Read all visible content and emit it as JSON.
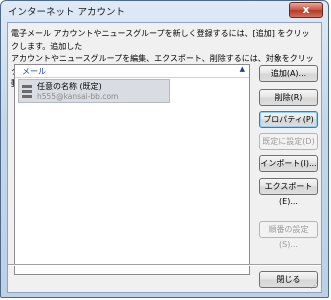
{
  "window": {
    "title": "インターネット アカウント",
    "close_glyph": "x"
  },
  "description": "電子メール アカウントやニュースグループを新しく登録するには、[追加] をクリックします。追加した\nアカウントやニュースグループを編集、エクスポート、削除するには、対象をクリックしてから、希望の\n動作をクリックします。",
  "list": {
    "header": "メール",
    "header_arrow": "▲",
    "accounts": [
      {
        "name": "任意の名称 (既定)",
        "email": "h555@kansai-bb.com",
        "selected": true
      }
    ]
  },
  "buttons": {
    "add": "追加(A)...",
    "remove": "削除(R)",
    "properties": "プロパティ(P)",
    "set_default": "既定に設定(D)",
    "import": "インポート(I)...",
    "export": "エクスポート(E)...",
    "set_order": "順番の設定(S)...",
    "close": "閉じる"
  },
  "colors": {
    "accent": "#1b3f9e",
    "selection": "#d9dde3",
    "focus_border": "#3c7fb1"
  }
}
